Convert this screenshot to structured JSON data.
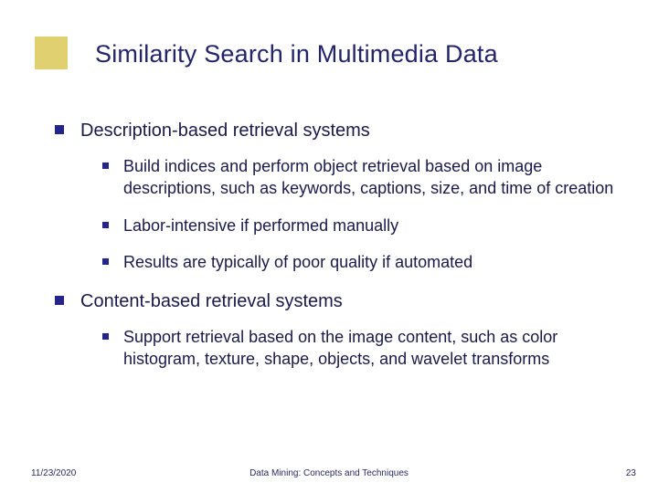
{
  "slide": {
    "title": "Similarity Search in Multimedia Data",
    "items": [
      {
        "text": "Description-based retrieval systems",
        "children": [
          {
            "text": "Build indices and perform object retrieval based on image descriptions, such as keywords, captions, size, and time of creation"
          },
          {
            "text": "Labor-intensive if performed manually"
          },
          {
            "text": "Results are typically of poor quality if automated"
          }
        ]
      },
      {
        "text": "Content-based retrieval systems",
        "children": [
          {
            "text": "Support retrieval based on the image content, such as color histogram, texture, shape, objects, and wavelet transforms"
          }
        ]
      }
    ]
  },
  "footer": {
    "date": "11/23/2020",
    "center": "Data Mining: Concepts and Techniques",
    "page": "23"
  }
}
